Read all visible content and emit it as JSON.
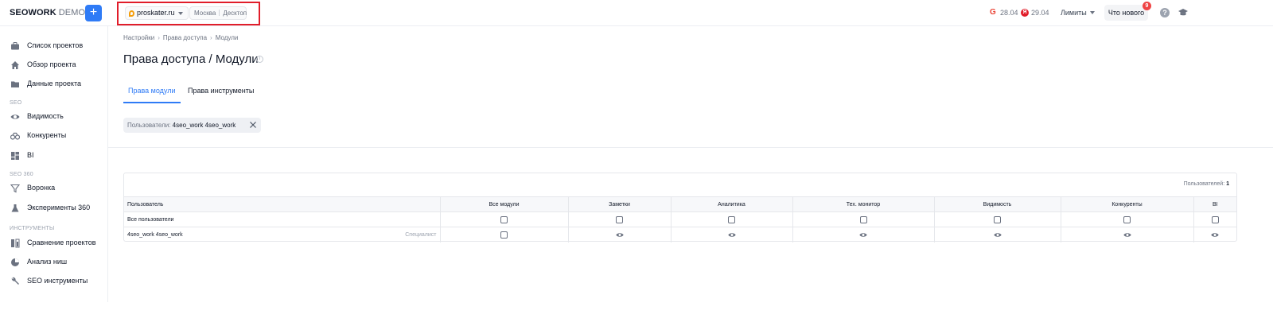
{
  "header": {
    "logo": "SEOWORK",
    "logo_suffix": "DEMO",
    "add_label": "+",
    "project": "proskater.ru",
    "region": "Москва",
    "device": "Десктоп",
    "google_score": "28.04",
    "yandex_score": "29.04",
    "yandex_badge": "Я",
    "google_badge": "G",
    "limits_label": "Лимиты",
    "whats_new_label": "Что нового",
    "notif_count": "9",
    "help_label": "?"
  },
  "sidebar": {
    "items": [
      {
        "label": "Список проектов",
        "icon": "briefcase-icon"
      },
      {
        "label": "Обзор проекта",
        "icon": "home-icon"
      },
      {
        "label": "Данные проекта",
        "icon": "folder-icon"
      },
      {
        "label": "Видимость",
        "icon": "eye-icon"
      },
      {
        "label": "Конкуренты",
        "icon": "binoculars-icon"
      },
      {
        "label": "BI",
        "icon": "dashboard-icon"
      },
      {
        "label": "Воронка",
        "icon": "funnel-icon"
      },
      {
        "label": "Эксперименты 360",
        "icon": "flask-icon"
      },
      {
        "label": "Сравнение проектов",
        "icon": "compare-icon"
      },
      {
        "label": "Анализ ниш",
        "icon": "pie-icon"
      },
      {
        "label": "SEO инструменты",
        "icon": "wrench-icon"
      }
    ],
    "sections": [
      "SEO",
      "SEO 360",
      "ИНСТРУМЕНТЫ"
    ]
  },
  "breadcrumb": [
    "Настройки",
    "Права доступа",
    "Модули"
  ],
  "page": {
    "title": "Права доступа / Модули",
    "info": "i"
  },
  "tabs": [
    "Права модули",
    "Права инструменты"
  ],
  "filter": {
    "label": "Пользователи:",
    "value": "4seo_work 4seo_work"
  },
  "table": {
    "users_count_label": "Пользователей:",
    "users_count": "1",
    "columns": [
      "Пользователь",
      "Все модули",
      "Заметки",
      "Аналитика",
      "Тех. монитор",
      "Видимость",
      "Конкуренты",
      "BI"
    ],
    "rows": [
      {
        "user": "Все пользователи",
        "role": "",
        "cells": [
          "checkbox",
          "checkbox",
          "checkbox",
          "checkbox",
          "checkbox",
          "checkbox",
          "checkbox"
        ]
      },
      {
        "user": "4seo_work 4seo_work",
        "role": "Специалист",
        "cells": [
          "checkbox",
          "eye",
          "eye",
          "eye",
          "eye",
          "eye",
          "eye"
        ]
      }
    ]
  },
  "colors": {
    "accent": "#2f7bf6",
    "highlight": "#e11d2a",
    "notification": "#ef4444"
  }
}
